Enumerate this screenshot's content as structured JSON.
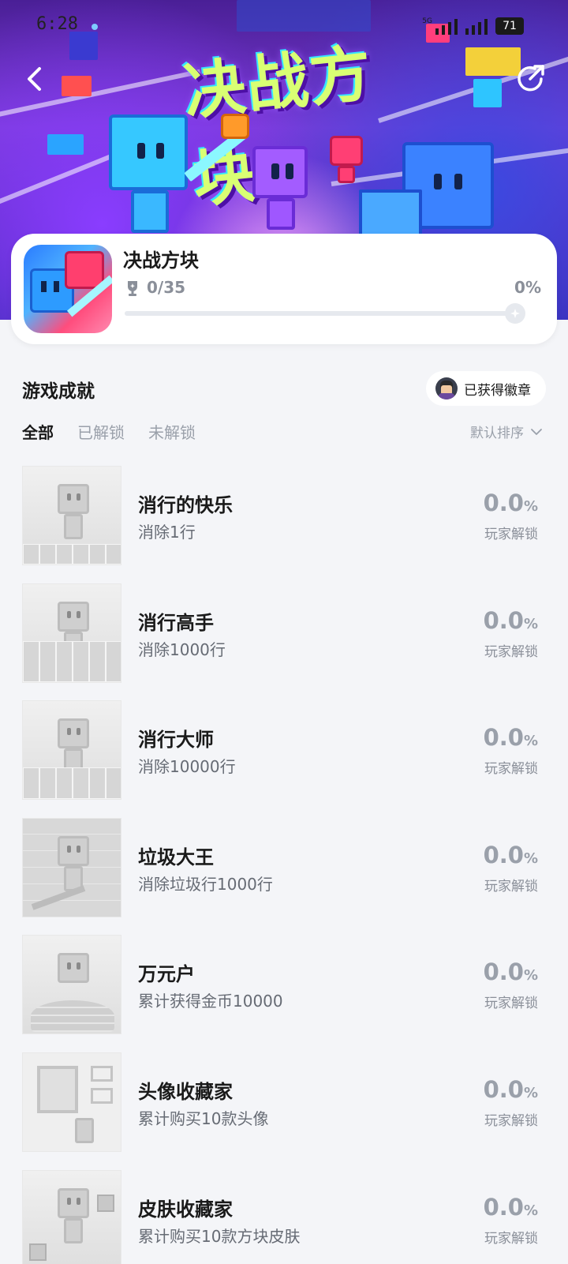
{
  "status_bar": {
    "time": "6:28",
    "network": "5G",
    "battery": "71"
  },
  "hero": {
    "title_art": "决战方块"
  },
  "game": {
    "name": "决战方块",
    "progress_count": "0/35",
    "progress_percent_text": "0%",
    "progress_fraction": 0.0
  },
  "achievements_section": {
    "title": "游戏成就",
    "badge_button": "已获得徽章",
    "tabs": [
      {
        "label": "全部",
        "active": true
      },
      {
        "label": "已解锁",
        "active": false
      },
      {
        "label": "未解锁",
        "active": false
      }
    ],
    "sort_label": "默认排序"
  },
  "achievements": [
    {
      "name": "消行的快乐",
      "desc": "消除1行",
      "rate": "0.0",
      "rate_unit": "%",
      "rate_label": "玩家解锁"
    },
    {
      "name": "消行高手",
      "desc": "消除1000行",
      "rate": "0.0",
      "rate_unit": "%",
      "rate_label": "玩家解锁"
    },
    {
      "name": "消行大师",
      "desc": "消除10000行",
      "rate": "0.0",
      "rate_unit": "%",
      "rate_label": "玩家解锁"
    },
    {
      "name": "垃圾大王",
      "desc": "消除垃圾行1000行",
      "rate": "0.0",
      "rate_unit": "%",
      "rate_label": "玩家解锁"
    },
    {
      "name": "万元户",
      "desc": "累计获得金币10000",
      "rate": "0.0",
      "rate_unit": "%",
      "rate_label": "玩家解锁"
    },
    {
      "name": "头像收藏家",
      "desc": "累计购买10款头像",
      "rate": "0.0",
      "rate_unit": "%",
      "rate_label": "玩家解锁"
    },
    {
      "name": "皮肤收藏家",
      "desc": "累计购买10款方块皮肤",
      "rate": "0.0",
      "rate_unit": "%",
      "rate_label": "玩家解锁"
    }
  ],
  "colors": {
    "accent_title": "#d9ff73",
    "hero_purple": "#7a3bd6",
    "muted": "#9aa0aa"
  },
  "icons": {
    "back": "chevron-left-icon",
    "share": "share-icon",
    "trophy": "trophy-icon",
    "sort": "chevron-down-icon"
  }
}
